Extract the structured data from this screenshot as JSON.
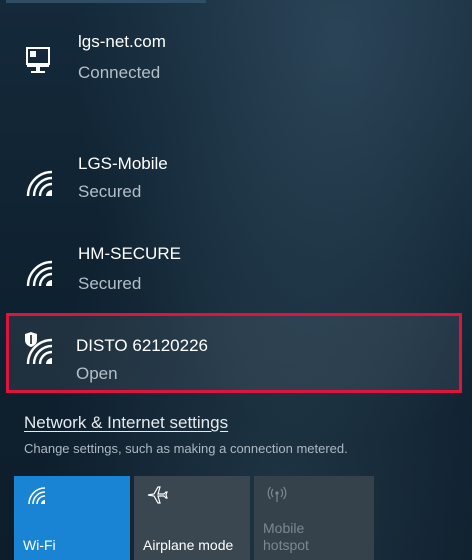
{
  "networks": [
    {
      "name": "lgs-net.com",
      "status": "Connected",
      "icon": "ethernet-computer-icon"
    },
    {
      "name": "LGS-Mobile",
      "status": "Secured",
      "icon": "wifi-icon"
    },
    {
      "name": "HM-SECURE",
      "status": "Secured",
      "icon": "wifi-icon"
    },
    {
      "name": "DISTO 62120226",
      "status": "Open",
      "icon": "wifi-open-shield-icon"
    }
  ],
  "settings": {
    "link": "Network & Internet settings",
    "description": "Change settings, such as making a connection metered."
  },
  "quick_actions": [
    {
      "label": "Wi-Fi",
      "icon": "wifi-icon",
      "state": "on"
    },
    {
      "label": "Airplane mode",
      "icon": "airplane-icon",
      "state": "off"
    },
    {
      "label_line1": "Mobile",
      "label_line2": "hotspot",
      "icon": "hotspot-icon",
      "state": "disabled"
    }
  ],
  "colors": {
    "highlight_border": "#e0133c",
    "wifi_tile": "#1984d4",
    "tile_off": "#3a4650"
  }
}
